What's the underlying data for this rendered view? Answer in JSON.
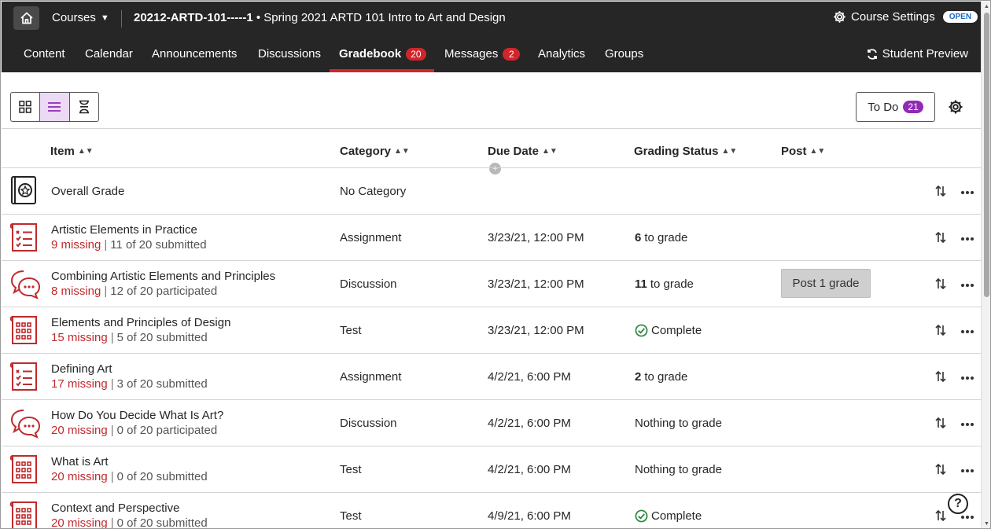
{
  "topbar": {
    "courses_label": "Courses",
    "course_code": "20212-ARTD-101-----1",
    "course_name": " • Spring 2021 ARTD 101 Intro to Art and Design",
    "settings_label": "Course Settings",
    "open_badge": "OPEN"
  },
  "nav": {
    "items": [
      "Content",
      "Calendar",
      "Announcements",
      "Discussions",
      "Gradebook",
      "Messages",
      "Analytics",
      "Groups"
    ],
    "gradebook_count": "20",
    "messages_count": "2",
    "student_preview": "Student Preview",
    "active": "Gradebook"
  },
  "toolbar": {
    "todo_label": "To Do",
    "todo_count": "21"
  },
  "table": {
    "headers": [
      "Item",
      "Category",
      "Due Date",
      "Grading Status",
      "Post"
    ],
    "resize_glyph": "+",
    "rows": [
      {
        "icon": "overall-grade-icon",
        "name": "Overall Grade",
        "missing": "",
        "progress": "",
        "category": "No Category",
        "due": "",
        "status_num": "",
        "status_text": "",
        "complete": false,
        "post": ""
      },
      {
        "icon": "assignment-icon",
        "name": "Artistic Elements in Practice",
        "missing": "9 missing",
        "progress": "11 of 20 submitted",
        "category": "Assignment",
        "due": "3/23/21, 12:00 PM",
        "status_num": "6",
        "status_text": "to grade",
        "complete": false,
        "post": ""
      },
      {
        "icon": "discussion-icon",
        "name": "Combining Artistic Elements and Principles",
        "missing": "8 missing",
        "progress": "12 of 20 participated",
        "category": "Discussion",
        "due": "3/23/21, 12:00 PM",
        "status_num": "11",
        "status_text": "to grade",
        "complete": false,
        "post": "Post 1 grade"
      },
      {
        "icon": "test-icon",
        "name": "Elements and Principles of Design",
        "missing": "15 missing",
        "progress": "5 of 20 submitted",
        "category": "Test",
        "due": "3/23/21, 12:00 PM",
        "status_num": "",
        "status_text": "Complete",
        "complete": true,
        "post": ""
      },
      {
        "icon": "assignment-icon",
        "name": "Defining Art",
        "missing": "17 missing",
        "progress": "3 of 20 submitted",
        "category": "Assignment",
        "due": "4/2/21, 6:00 PM",
        "status_num": "2",
        "status_text": "to grade",
        "complete": false,
        "post": ""
      },
      {
        "icon": "discussion-icon",
        "name": "How Do You Decide What Is Art?",
        "missing": "20 missing",
        "progress": "0 of 20 participated",
        "category": "Discussion",
        "due": "4/2/21, 6:00 PM",
        "status_num": "",
        "status_text": "Nothing to grade",
        "complete": false,
        "post": ""
      },
      {
        "icon": "test-icon",
        "name": "What is Art",
        "missing": "20 missing",
        "progress": "0 of 20 submitted",
        "category": "Test",
        "due": "4/2/21, 6:00 PM",
        "status_num": "",
        "status_text": "Nothing to grade",
        "complete": false,
        "post": ""
      },
      {
        "icon": "test-icon",
        "name": "Context and Perspective",
        "missing": "20 missing",
        "progress": "0 of 20 submitted",
        "category": "Test",
        "due": "4/9/21, 6:00 PM",
        "status_num": "",
        "status_text": "Complete",
        "complete": true,
        "post": ""
      }
    ]
  },
  "help_glyph": "?",
  "colors": {
    "topbar_bg": "#262626",
    "accent_red": "#d0262b",
    "missing_red": "#c12a2d",
    "todo_purple": "#8f2bb5",
    "complete_green": "#2e8540",
    "icon_red": "#c12a2d"
  }
}
